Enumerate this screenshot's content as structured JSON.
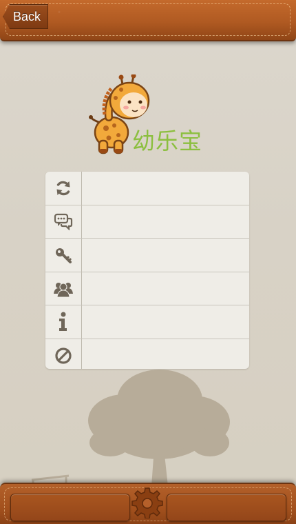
{
  "header": {
    "back_label": "Back"
  },
  "brand": {
    "app_name": "幼乐宝",
    "accent_color": "#8cbf3f"
  },
  "menu": {
    "items": [
      {
        "icon": "refresh-icon",
        "label": ""
      },
      {
        "icon": "chat-bubbles-icon",
        "label": ""
      },
      {
        "icon": "key-icon",
        "label": ""
      },
      {
        "icon": "users-icon",
        "label": ""
      },
      {
        "icon": "info-icon",
        "label": ""
      },
      {
        "icon": "block-icon",
        "label": ""
      }
    ]
  },
  "footer": {
    "left_tab_icon": "",
    "center_icon": "gear-icon",
    "right_tab_icon": ""
  },
  "colors": {
    "leather": "#b05a22",
    "background": "#d8d2c6",
    "card": "#efede7",
    "icon": "#6f6659"
  }
}
